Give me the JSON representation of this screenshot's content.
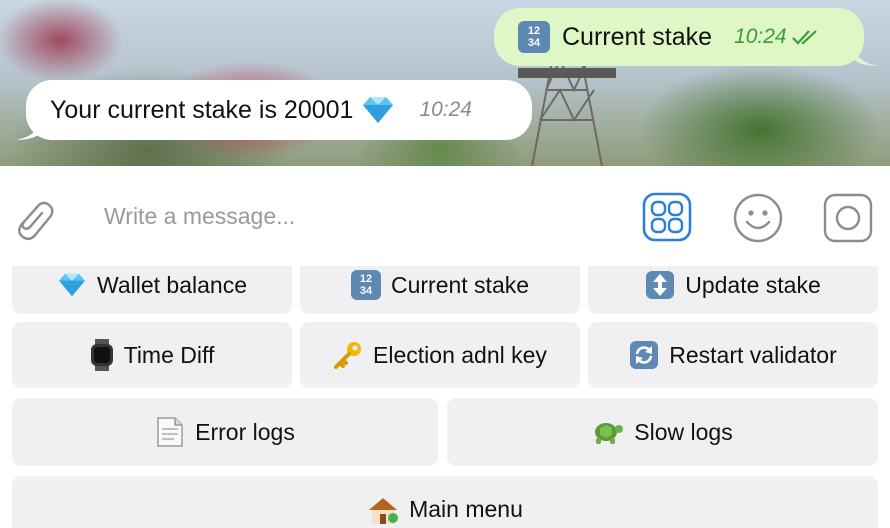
{
  "chat": {
    "outgoing": {
      "text": "Current stake",
      "time": "10:24"
    },
    "incoming": {
      "text": "Your current stake is 20001",
      "time": "10:24"
    }
  },
  "input": {
    "placeholder": "Write a message..."
  },
  "keyboard": {
    "row1": [
      {
        "label": "Wallet balance",
        "icon": "gem-icon"
      },
      {
        "label": "Current stake",
        "icon": "numbers-icon"
      },
      {
        "label": "Update stake",
        "icon": "up-down-arrow-icon"
      }
    ],
    "row2": [
      {
        "label": "Time Diff",
        "icon": "watch-icon"
      },
      {
        "label": "Election adnl key",
        "icon": "key-icon"
      },
      {
        "label": "Restart validator",
        "icon": "refresh-icon"
      }
    ],
    "row3": [
      {
        "label": "Error logs",
        "icon": "page-icon"
      },
      {
        "label": "Slow logs",
        "icon": "turtle-icon"
      }
    ],
    "row4": [
      {
        "label": "Main menu",
        "icon": "house-icon"
      }
    ]
  },
  "colors": {
    "outgoing_bubble": "#dff7c6",
    "incoming_bubble": "#ffffff",
    "accent": "#2b7fd8",
    "time_outgoing": "#3f9a3a",
    "keyboard_button": "#f0f0f2"
  }
}
